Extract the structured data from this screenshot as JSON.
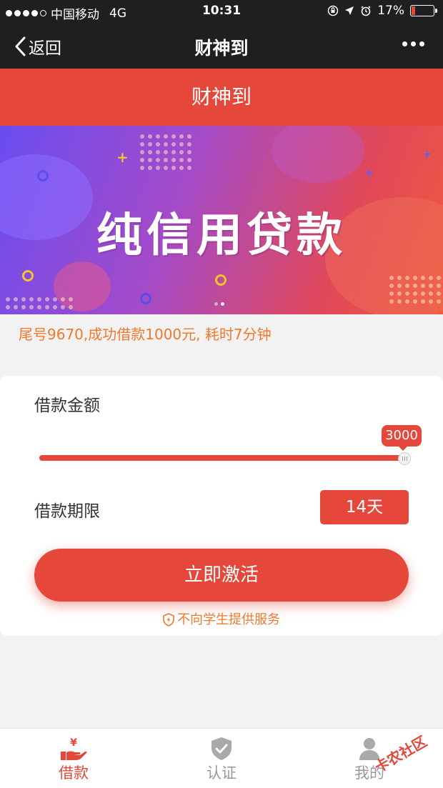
{
  "status_bar": {
    "carrier": "中国移动",
    "network": "4G",
    "time": "10:31",
    "battery": "17%"
  },
  "nav": {
    "back_label": "返回",
    "title": "财神到"
  },
  "header": {
    "title": "财神到"
  },
  "banner": {
    "title": "纯信用贷款",
    "slides": 2,
    "active_slide": 1
  },
  "ticker": {
    "text": "尾号9670,成功借款1000元, 耗时7分钟"
  },
  "loan_form": {
    "amount_label": "借款金额",
    "amount_value": "3000",
    "amount_fraction": 1.0,
    "term_label": "借款期限",
    "term_value": "14天",
    "submit_label": "立即激活",
    "notice": "不向学生提供服务"
  },
  "tabbar": {
    "items": [
      {
        "label": "借款",
        "icon": "loan-hand-yen-icon",
        "active": true
      },
      {
        "label": "认证",
        "icon": "shield-check-icon",
        "active": false
      },
      {
        "label": "我的",
        "icon": "user-icon",
        "active": false
      }
    ]
  },
  "watermark": {
    "text": "卡农社区"
  },
  "colors": {
    "accent": "#e5473a",
    "orange": "#ef7a2c",
    "nav_bg": "#1f1f21"
  }
}
